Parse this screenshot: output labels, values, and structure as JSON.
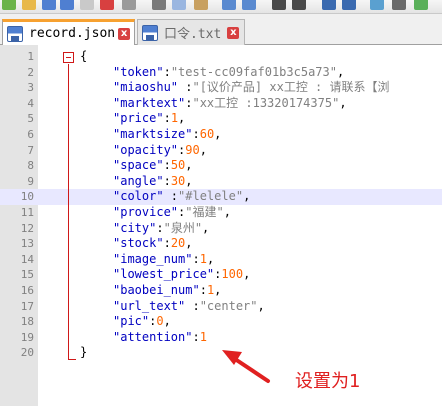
{
  "tabs": [
    {
      "label": "record.json",
      "active": true,
      "close": "x"
    },
    {
      "label": "口令.txt",
      "active": false,
      "close": "x"
    }
  ],
  "lines": [
    {
      "num": "1",
      "text": "{"
    },
    {
      "num": "2",
      "key": "\"token\"",
      "sep": ":",
      "val": "\"test-cc09faf01b3c5a73\"",
      "end": ","
    },
    {
      "num": "3",
      "key": "\"miaoshu\"",
      "sep": " :",
      "val": "\"[议价产品] xx工控 : 请联系【浏",
      "end": ""
    },
    {
      "num": "4",
      "key": "\"marktext\"",
      "sep": ":",
      "val": "\"xx工控 :13320174375\"",
      "end": ","
    },
    {
      "num": "5",
      "key": "\"price\"",
      "sep": ":",
      "val": "1",
      "end": ","
    },
    {
      "num": "6",
      "key": "\"marktsize\"",
      "sep": ":",
      "val": "60",
      "end": ","
    },
    {
      "num": "7",
      "key": "\"opacity\"",
      "sep": ":",
      "val": "90",
      "end": ","
    },
    {
      "num": "8",
      "key": "\"space\"",
      "sep": ":",
      "val": "50",
      "end": ","
    },
    {
      "num": "9",
      "key": "\"angle\"",
      "sep": ":",
      "val": "30",
      "end": ","
    },
    {
      "num": "10",
      "key": "\"color\"",
      "sep": " :",
      "val": "\"#lelele\"",
      "end": ","
    },
    {
      "num": "11",
      "key": "\"provice\"",
      "sep": ":",
      "val": "\"福建\"",
      "end": ","
    },
    {
      "num": "12",
      "key": "\"city\"",
      "sep": ":",
      "val": "\"泉州\"",
      "end": ","
    },
    {
      "num": "13",
      "key": "\"stock\"",
      "sep": ":",
      "val": "20",
      "end": ","
    },
    {
      "num": "14",
      "key": "\"image_num\"",
      "sep": ":",
      "val": "1",
      "end": ","
    },
    {
      "num": "15",
      "key": "\"lowest_price\"",
      "sep": ":",
      "val": "100",
      "end": ","
    },
    {
      "num": "16",
      "key": "\"baobei_num\"",
      "sep": ":",
      "val": "1",
      "end": ","
    },
    {
      "num": "17",
      "key": "\"url_text\"",
      "sep": " :",
      "val": "\"center\"",
      "end": ","
    },
    {
      "num": "18",
      "key": "\"pic\"",
      "sep": ":",
      "val": "0",
      "end": ","
    },
    {
      "num": "19",
      "key": "\"attention\"",
      "sep": ":",
      "val": "1",
      "end": ""
    },
    {
      "num": "20",
      "text": "}"
    }
  ],
  "current_line": 10,
  "annotation": "设置为1",
  "colors": {
    "key": "#0000c0",
    "string": "#808080",
    "number": "#ff6600",
    "fold": "#d01818",
    "current_line_bg": "#e8e8ff",
    "annotation": "#e02020",
    "tab_accent": "#f7a130"
  }
}
